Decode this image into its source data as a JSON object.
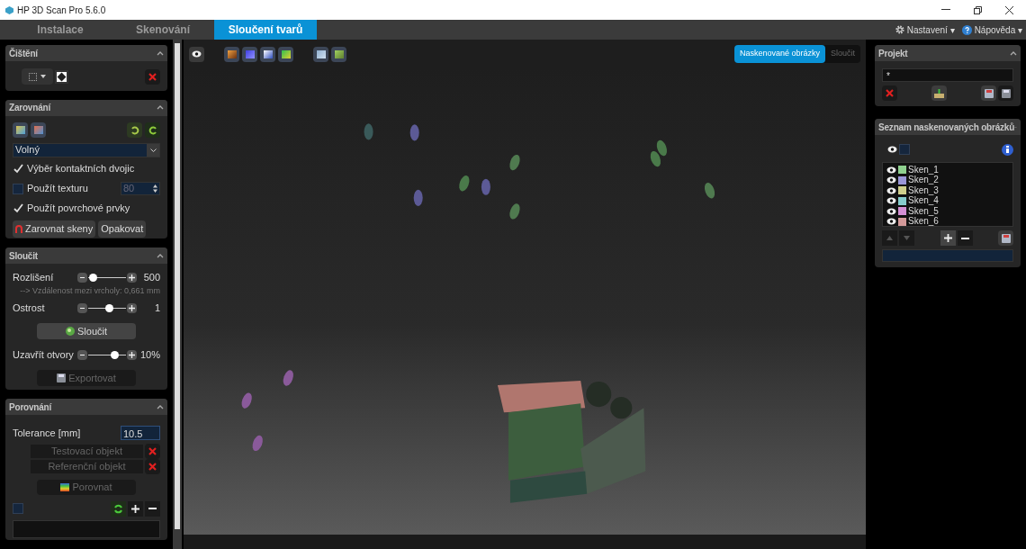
{
  "window": {
    "title": "HP 3D Scan Pro 5.6.0"
  },
  "tabs": [
    {
      "label": "Instalace",
      "selected": false
    },
    {
      "label": "Skenování",
      "selected": false
    },
    {
      "label": "Sloučení tvarů",
      "selected": true
    }
  ],
  "menu": [
    {
      "label": "Nastavení ▾",
      "kind": "settings"
    },
    {
      "label": "Nápověda ▾",
      "kind": "help"
    }
  ],
  "cleaning": {
    "title": "Čištění"
  },
  "alignment": {
    "title": "Zarovnání",
    "mode": "Volný",
    "options": [
      {
        "label": "Výběr kontaktních dvojic",
        "checked": true
      },
      {
        "label": "Použít texturu",
        "checked": false,
        "value": "80"
      },
      {
        "label": "Použít povrchové prvky",
        "checked": true
      }
    ],
    "buttons": [
      "Zarovnat skeny",
      "Opakovat"
    ]
  },
  "merge": {
    "title": "Sloučit",
    "sliders": [
      {
        "label": "Rozlišení",
        "level": 0.12,
        "reading": "500",
        "note": "--> Vzdálenost mezi vrcholy: 0,661 mm"
      },
      {
        "label": "Ostrost",
        "level": 0.55,
        "reading": "1"
      }
    ],
    "merge_button": {
      "label": "Sloučit",
      "disabled": false
    },
    "holes": {
      "label": "Uzavřít otvory",
      "level": 0.7,
      "reading": "10%"
    },
    "export_button": {
      "label": "Exportovat",
      "disabled": true
    }
  },
  "comparison": {
    "title": "Porovnání",
    "tolerance_label": "Tolerance [mm]",
    "tolerance": "10.5",
    "objects": [
      "Testovací objekt",
      "Referenční objekt"
    ],
    "compare_button": "Porovnat",
    "select_all": {
      "checked": false
    }
  },
  "view_toggle": [
    {
      "label": "Naskenované obrázky",
      "selected": true
    },
    {
      "label": "Sloučit",
      "selected": false
    }
  ],
  "project": {
    "title": "Projekt",
    "name": "*"
  },
  "scans": {
    "title": "Seznam naskenovaných obrázků",
    "all_checked": false,
    "items": [
      {
        "name": "Sken_1",
        "color": "#8fd08f",
        "visible": true
      },
      {
        "name": "Sken_2",
        "color": "#9a96d8",
        "visible": true
      },
      {
        "name": "Sken_3",
        "color": "#cfcf8c",
        "visible": true
      },
      {
        "name": "Sken_4",
        "color": "#86cccc",
        "visible": true
      },
      {
        "name": "Sken_5",
        "color": "#d48fd4",
        "visible": true
      },
      {
        "name": "Sken_6",
        "color": "#d49a9a",
        "visible": true
      }
    ]
  }
}
